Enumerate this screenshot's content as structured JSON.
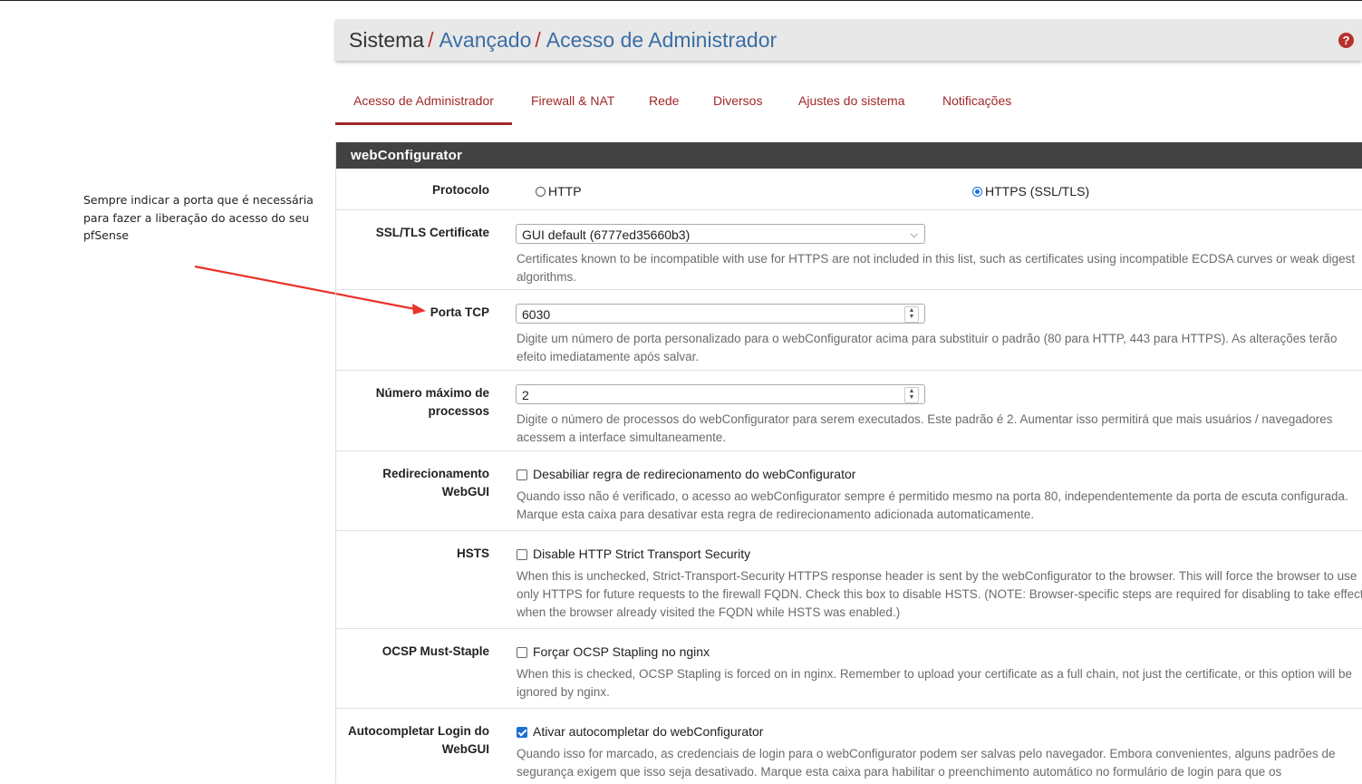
{
  "breadcrumb": {
    "root": "Sistema",
    "sep": "/",
    "level2": "Avançado",
    "level3": "Acesso de Administrador"
  },
  "help_glyph": "?",
  "tabs": [
    {
      "label": "Acesso de Administrador",
      "active": true
    },
    {
      "label": "Firewall & NAT"
    },
    {
      "label": "Rede"
    },
    {
      "label": "Diversos"
    },
    {
      "label": "Ajustes do sistema"
    },
    {
      "label": "Notificações"
    }
  ],
  "annotation": {
    "text": "Sempre indicar a porta que é necessária para fazer a liberação do acesso do seu pfSense",
    "color": "#e8322a"
  },
  "panel": {
    "title": "webConfigurator",
    "protocol": {
      "label": "Protocolo",
      "opt_http": "HTTP",
      "opt_https": "HTTPS (SSL/TLS)",
      "selected": "HTTPS (SSL/TLS)"
    },
    "cert": {
      "label": "SSL/TLS Certificate",
      "value": "GUI default (6777ed35660b3)",
      "help": "Certificates known to be incompatible with use for HTTPS are not included in this list, such as certificates using incompatible ECDSA curves or weak digest algorithms."
    },
    "port": {
      "label": "Porta TCP",
      "value": "6030",
      "help": "Digite um número de porta personalizado para o webConfigurator acima para substituir o padrão (80 para HTTP, 443 para HTTPS). As alterações terão efeito imediatamente após salvar."
    },
    "maxproc": {
      "label": "Número máximo de processos",
      "value": "2",
      "help": "Digite o número de processos do webConfigurator para serem executados. Este padrão é 2. Aumentar isso permitirá que mais usuários / navegadores acessem a interface simultaneamente."
    },
    "redirect": {
      "label": "Redirecionamento WebGUI",
      "checkbox": "Desabiliar regra de redirecionamento do webConfigurator",
      "checked": false,
      "help": "Quando isso não é verificado, o acesso ao webConfigurator sempre é permitido mesmo na porta 80, independentemente da porta de escuta configurada. Marque esta caixa para desativar esta regra de redirecionamento adicionada automaticamente."
    },
    "hsts": {
      "label": "HSTS",
      "checkbox": "Disable HTTP Strict Transport Security",
      "checked": false,
      "help": "When this is unchecked, Strict-Transport-Security HTTPS response header is sent by the webConfigurator to the browser. This will force the browser to use only HTTPS for future requests to the firewall FQDN. Check this box to disable HSTS. (NOTE: Browser-specific steps are required for disabling to take effect when the browser already visited the FQDN while HSTS was enabled.)"
    },
    "ocsp": {
      "label": "OCSP Must-Staple",
      "checkbox": "Forçar OCSP Stapling no nginx",
      "checked": false,
      "help": "When this is checked, OCSP Stapling is forced on in nginx. Remember to upload your certificate as a full chain, not just the certificate, or this option will be ignored by nginx."
    },
    "autocomplete": {
      "label": "Autocompletar Login do WebGUI",
      "checkbox": "Ativar autocompletar do webConfigurator",
      "checked": true,
      "help": "Quando isso for marcado, as credenciais de login para o webConfigurator podem ser salvas pelo navegador. Embora convenientes, alguns padrões de segurança exigem que isso seja desativado. Marque esta caixa para habilitar o preenchimento automático no formulário de login para que os"
    }
  }
}
